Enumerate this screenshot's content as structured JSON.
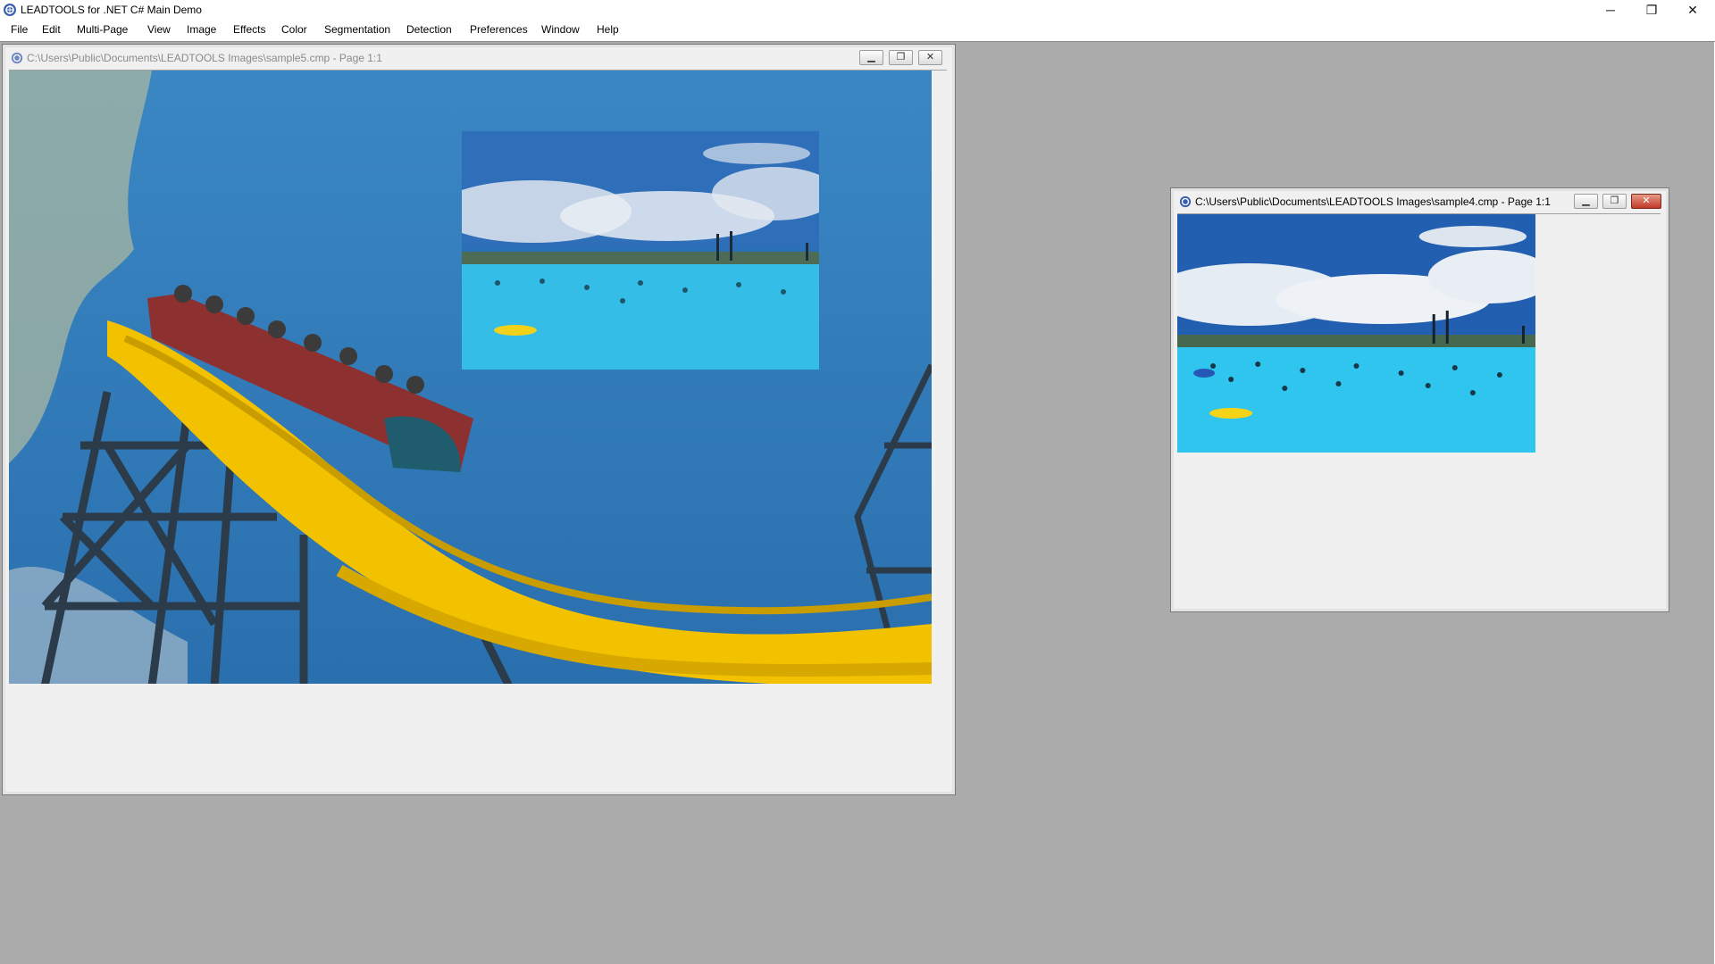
{
  "app": {
    "title": "LEADTOOLS for .NET C# Main Demo",
    "controls": {
      "minimize": "─",
      "restore": "❐",
      "close": "✕"
    }
  },
  "menu": [
    {
      "label": "File",
      "hotkey": "F"
    },
    {
      "label": "Edit",
      "hotkey": "E"
    },
    {
      "label": "Multi-Page",
      "hotkey": "M"
    },
    {
      "label": "View",
      "hotkey": "V"
    },
    {
      "label": "Image",
      "hotkey": "I"
    },
    {
      "label": "Effects",
      "hotkey": "f"
    },
    {
      "label": "Color",
      "hotkey": "C"
    },
    {
      "label": "Segmentation",
      "hotkey": "S"
    },
    {
      "label": "Detection",
      "hotkey": "D"
    },
    {
      "label": "Preferences",
      "hotkey": "P"
    },
    {
      "label": "Window",
      "hotkey": "W"
    },
    {
      "label": "Help",
      "hotkey": "H"
    }
  ],
  "windows": {
    "sample5": {
      "title": "C:\\Users\\Public\\Documents\\LEADTOOLS Images\\sample5.cmp - Page 1:1",
      "active": false,
      "image": "roller-coaster-photo",
      "overlay_image": "water-park-photo"
    },
    "sample4": {
      "title": "C:\\Users\\Public\\Documents\\LEADTOOLS Images\\sample4.cmp - Page 1:1",
      "active": true,
      "image": "water-park-photo"
    }
  },
  "colors": {
    "mdi_background": "#ababab",
    "sky": "#2f7fbf",
    "coaster_track": "#f2c200",
    "pool": "#31c2ea",
    "close_active": "#c0392b"
  }
}
